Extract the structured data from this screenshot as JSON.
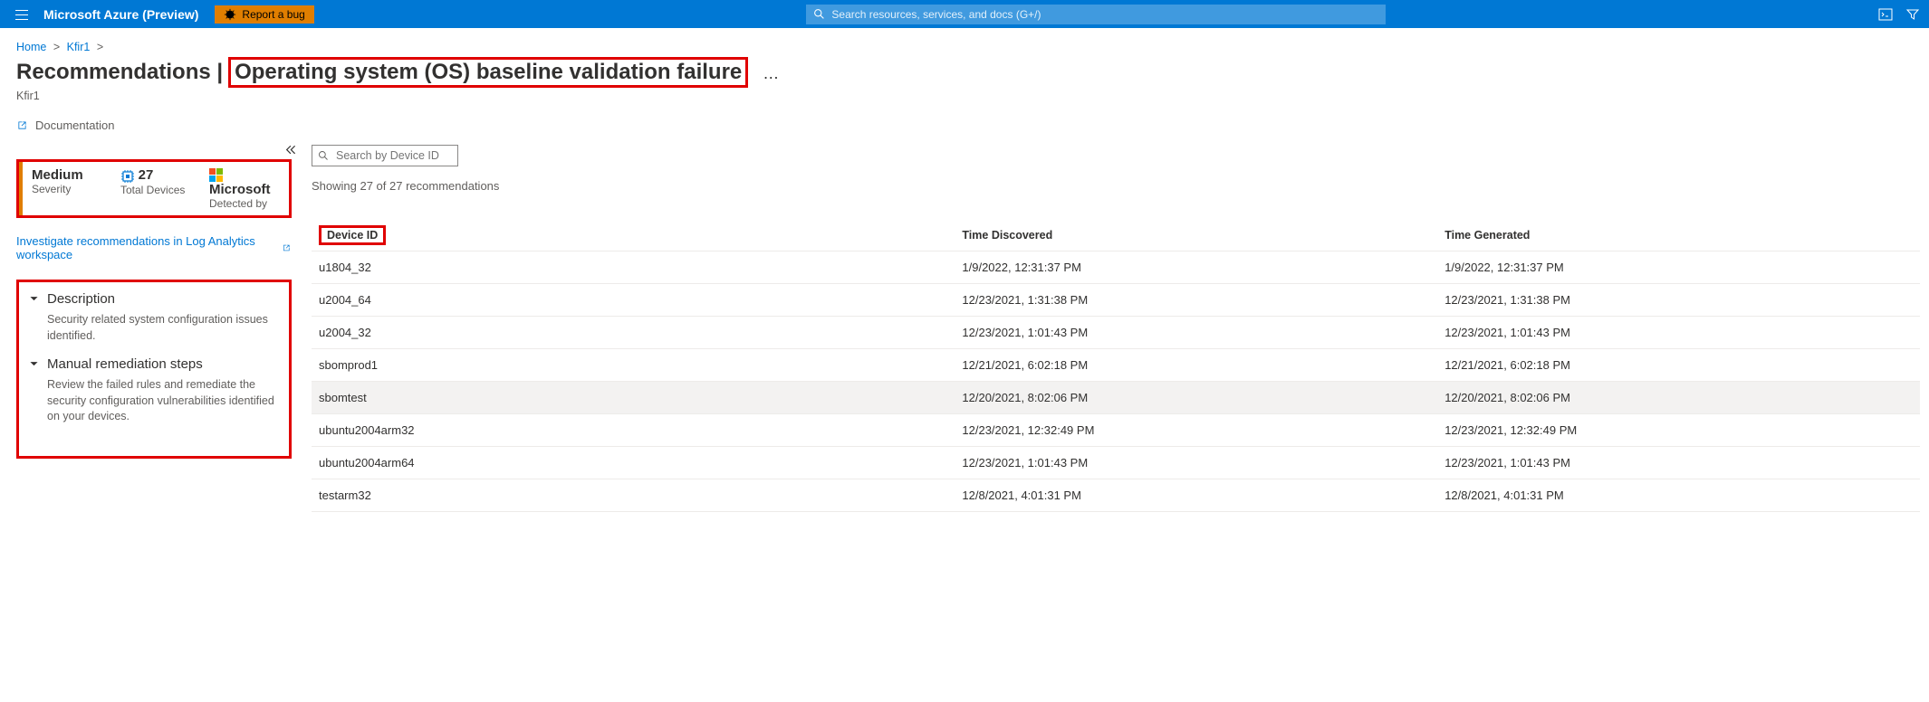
{
  "header": {
    "brand": "Microsoft Azure (Preview)",
    "bug_button": "Report a bug",
    "search_placeholder": "Search resources, services, and docs (G+/)"
  },
  "breadcrumb": {
    "home": "Home",
    "child": "Kfir1"
  },
  "page": {
    "title_prefix": "Recommendations |",
    "title_main": "Operating system (OS) baseline validation failure",
    "subtitle": "Kfir1",
    "documentation": "Documentation"
  },
  "stats": {
    "severity": {
      "value": "Medium",
      "label": "Severity"
    },
    "devices": {
      "value": "27",
      "label": "Total Devices"
    },
    "detected": {
      "value": "Microsoft",
      "label": "Detected by"
    }
  },
  "investigate_link": "Investigate recommendations in Log Analytics workspace",
  "sections": {
    "description": {
      "title": "Description",
      "body": "Security related system configuration issues identified."
    },
    "remediation": {
      "title": "Manual remediation steps",
      "body": "Review the failed rules and remediate the security configuration vulnerabilities identified on your devices."
    }
  },
  "list": {
    "filter_placeholder": "Search by Device ID",
    "showing": "Showing 27 of 27 recommendations",
    "columns": {
      "device_id": "Device ID",
      "time_discovered": "Time Discovered",
      "time_generated": "Time Generated"
    },
    "rows": [
      {
        "device": "u1804_32",
        "discovered": "1/9/2022, 12:31:37 PM",
        "generated": "1/9/2022, 12:31:37 PM"
      },
      {
        "device": "u2004_64",
        "discovered": "12/23/2021, 1:31:38 PM",
        "generated": "12/23/2021, 1:31:38 PM"
      },
      {
        "device": "u2004_32",
        "discovered": "12/23/2021, 1:01:43 PM",
        "generated": "12/23/2021, 1:01:43 PM"
      },
      {
        "device": "sbomprod1",
        "discovered": "12/21/2021, 6:02:18 PM",
        "generated": "12/21/2021, 6:02:18 PM"
      },
      {
        "device": "sbomtest",
        "discovered": "12/20/2021, 8:02:06 PM",
        "generated": "12/20/2021, 8:02:06 PM",
        "highlight": true
      },
      {
        "device": "ubuntu2004arm32",
        "discovered": "12/23/2021, 12:32:49 PM",
        "generated": "12/23/2021, 12:32:49 PM"
      },
      {
        "device": "ubuntu2004arm64",
        "discovered": "12/23/2021, 1:01:43 PM",
        "generated": "12/23/2021, 1:01:43 PM"
      },
      {
        "device": "testarm32",
        "discovered": "12/8/2021, 4:01:31 PM",
        "generated": "12/8/2021, 4:01:31 PM"
      }
    ]
  }
}
